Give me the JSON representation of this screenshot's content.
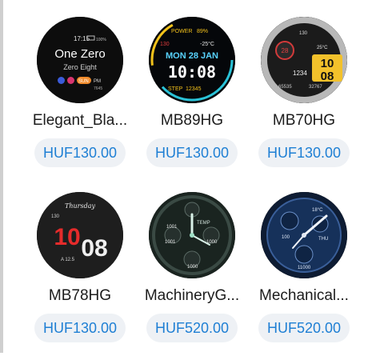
{
  "watchfaces": [
    {
      "name": "Elegant_Bla...",
      "price": "HUF130.00",
      "face": {
        "time": "17:15",
        "battery": "100%",
        "title": "One Zero",
        "subtitle": "Zero Eight",
        "day_mon": "11",
        "day_num": "15",
        "day_name": "SUN",
        "am_pm": "PM",
        "pm_label": "PM",
        "steps": "7645"
      }
    },
    {
      "name": "MB89HG",
      "price": "HUF130.00",
      "face": {
        "power_label": "POWER",
        "power_value": "89%",
        "heart": "130",
        "temp": "-25°C",
        "date": "MON 28 JAN",
        "time": "10:08",
        "steps_label": "STEP",
        "steps": "12345"
      }
    },
    {
      "name": "MB70HG",
      "price": "HUF130.00",
      "face": {
        "heart": "130",
        "temp": "25°C",
        "day": "28",
        "hour": "10",
        "min": "08",
        "steps_a": "65535",
        "steps_b": "32767",
        "num": "1234"
      }
    },
    {
      "name": "MB78HG",
      "price": "HUF130.00",
      "face": {
        "heart": "130",
        "day_name": "Thursday",
        "hour": "10",
        "min": "08",
        "sub": "A 12.5"
      }
    },
    {
      "name": "MachineryG...",
      "price": "HUF520.00",
      "face": {
        "temp": "TEMP",
        "value_a": "1001",
        "value_b": "1001",
        "value_c": "1000",
        "value_d": "1000"
      }
    },
    {
      "name": "Mechanical...",
      "price": "HUF520.00",
      "face": {
        "temp": "18°C",
        "heart": "100",
        "day": "THU",
        "steps": "11000"
      }
    }
  ]
}
